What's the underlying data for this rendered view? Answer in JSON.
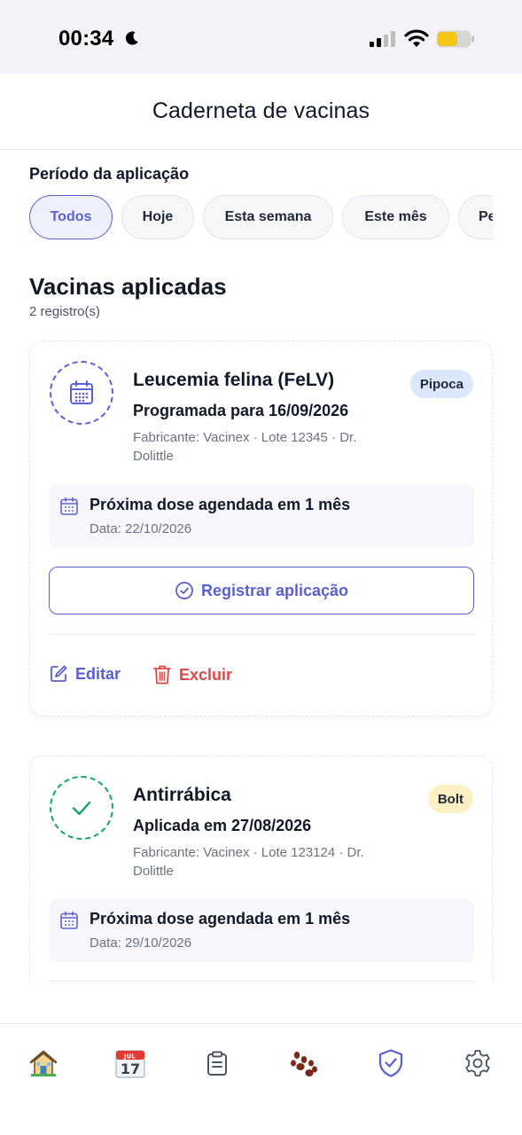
{
  "status_bar": {
    "time": "00:34"
  },
  "header": {
    "title": "Caderneta de vacinas"
  },
  "filter": {
    "label": "Período da aplicação",
    "chips": [
      "Todos",
      "Hoje",
      "Esta semana",
      "Este mês",
      "Pe"
    ],
    "selected": "Todos"
  },
  "section": {
    "title": "Vacinas aplicadas",
    "count": "2 registro(s)"
  },
  "cards": [
    {
      "name": "Leucemia felina (FeLV)",
      "date_text": "Programada para 16/09/2026",
      "meta": "Fabricante: Vacinex · Lote 12345 · Dr. Dolittle",
      "pet": "Pipoca",
      "status_icon": "calendar-icon",
      "next_title": "Próxima dose agendada em 1 mês",
      "next_date": "Data: 22/10/2026",
      "register_label": "Registrar aplicação",
      "edit_label": "Editar",
      "delete_label": "Excluir"
    },
    {
      "name": "Antirrábica",
      "date_text": "Aplicada em 27/08/2026",
      "meta": "Fabricante: Vacinex · Lote 123124 · Dr. Dolittle",
      "pet": "Bolt",
      "status_icon": "check-icon",
      "next_title": "Próxima dose agendada em 1 mês",
      "next_date": "Data: 29/10/2026"
    }
  ],
  "bottom_nav": {
    "items": [
      "home-icon",
      "calendar-17-icon",
      "clipboard-icon",
      "paw-icon",
      "shield-check-icon",
      "gear-icon"
    ],
    "active": "shield-check-icon",
    "calendar_month": "JUL",
    "calendar_day": "17"
  },
  "colors": {
    "accent": "#5a5fcf",
    "danger": "#e04848",
    "success": "#10a36e",
    "pet_badge_blue": "#dbe8fb",
    "pet_badge_yellow": "#fdf1c4"
  }
}
